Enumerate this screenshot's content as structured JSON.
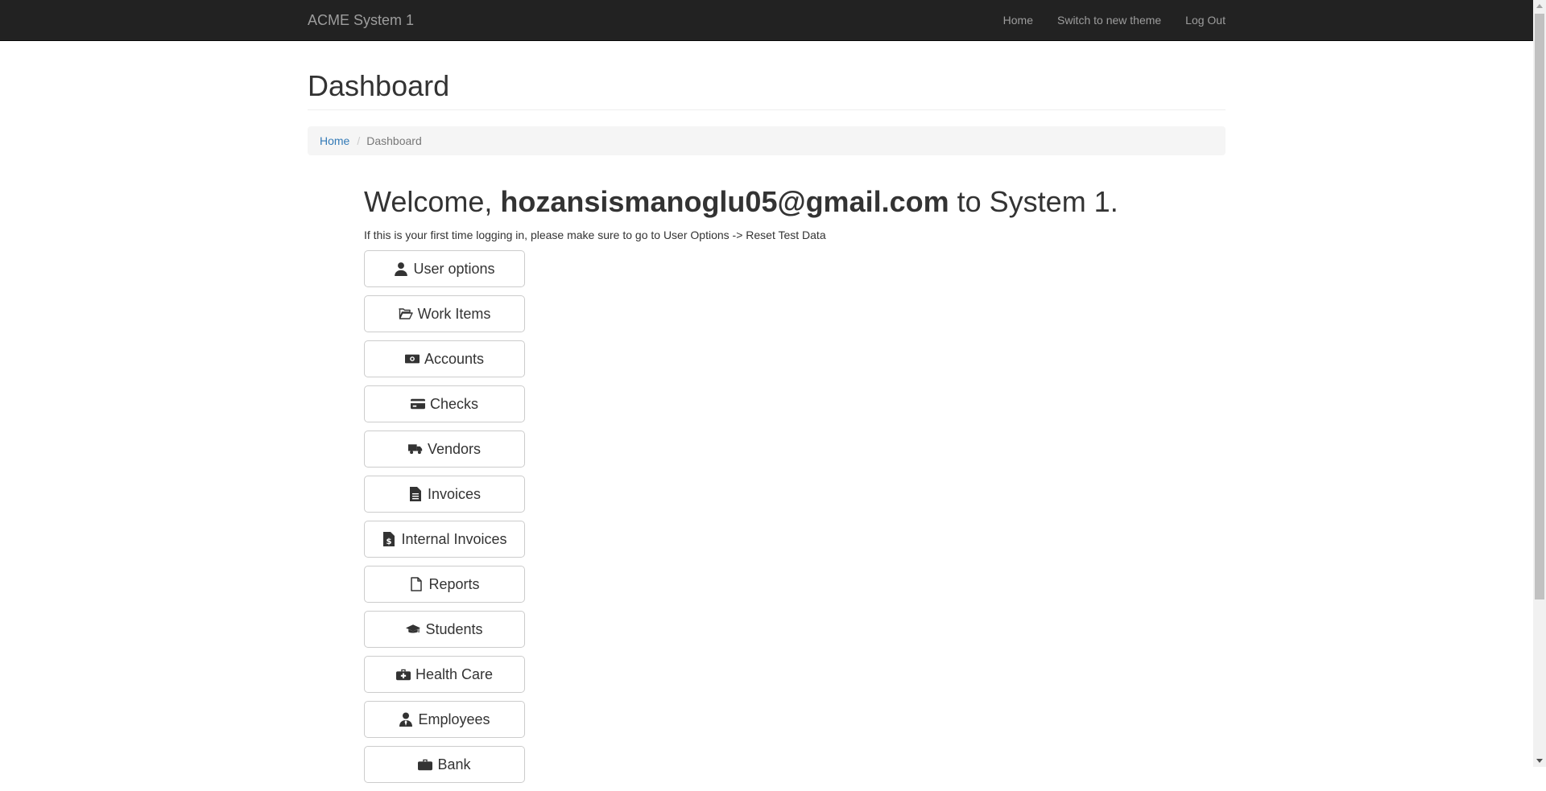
{
  "navbar": {
    "brand": "ACME System 1",
    "links": [
      "Home",
      "Switch to new theme",
      "Log Out"
    ]
  },
  "page": {
    "title": "Dashboard"
  },
  "breadcrumb": {
    "home": "Home",
    "current": "Dashboard"
  },
  "welcome": {
    "prefix": "Welcome, ",
    "email": "hozansismanoglu05@gmail.com",
    "suffix": " to System 1.",
    "note": "If this is your first time logging in, please make sure to go to User Options -> Reset Test Data"
  },
  "buttons": [
    {
      "label": "User options",
      "icon": "user-icon"
    },
    {
      "label": "Work Items",
      "icon": "folder-open-icon"
    },
    {
      "label": "Accounts",
      "icon": "money-icon"
    },
    {
      "label": "Checks",
      "icon": "credit-card-icon"
    },
    {
      "label": "Vendors",
      "icon": "truck-icon"
    },
    {
      "label": "Invoices",
      "icon": "file-text-icon"
    },
    {
      "label": "Internal Invoices",
      "icon": "file-invoice-dollar-icon"
    },
    {
      "label": "Reports",
      "icon": "file-icon"
    },
    {
      "label": "Students",
      "icon": "graduation-cap-icon"
    },
    {
      "label": "Health Care",
      "icon": "medkit-icon"
    },
    {
      "label": "Employees",
      "icon": "user-tie-icon"
    },
    {
      "label": "Bank",
      "icon": "briefcase-icon"
    }
  ],
  "colors": {
    "navbar_bg": "#222222",
    "navbar_text": "#9d9d9d",
    "link": "#337ab7",
    "breadcrumb_bg": "#f5f5f5"
  }
}
